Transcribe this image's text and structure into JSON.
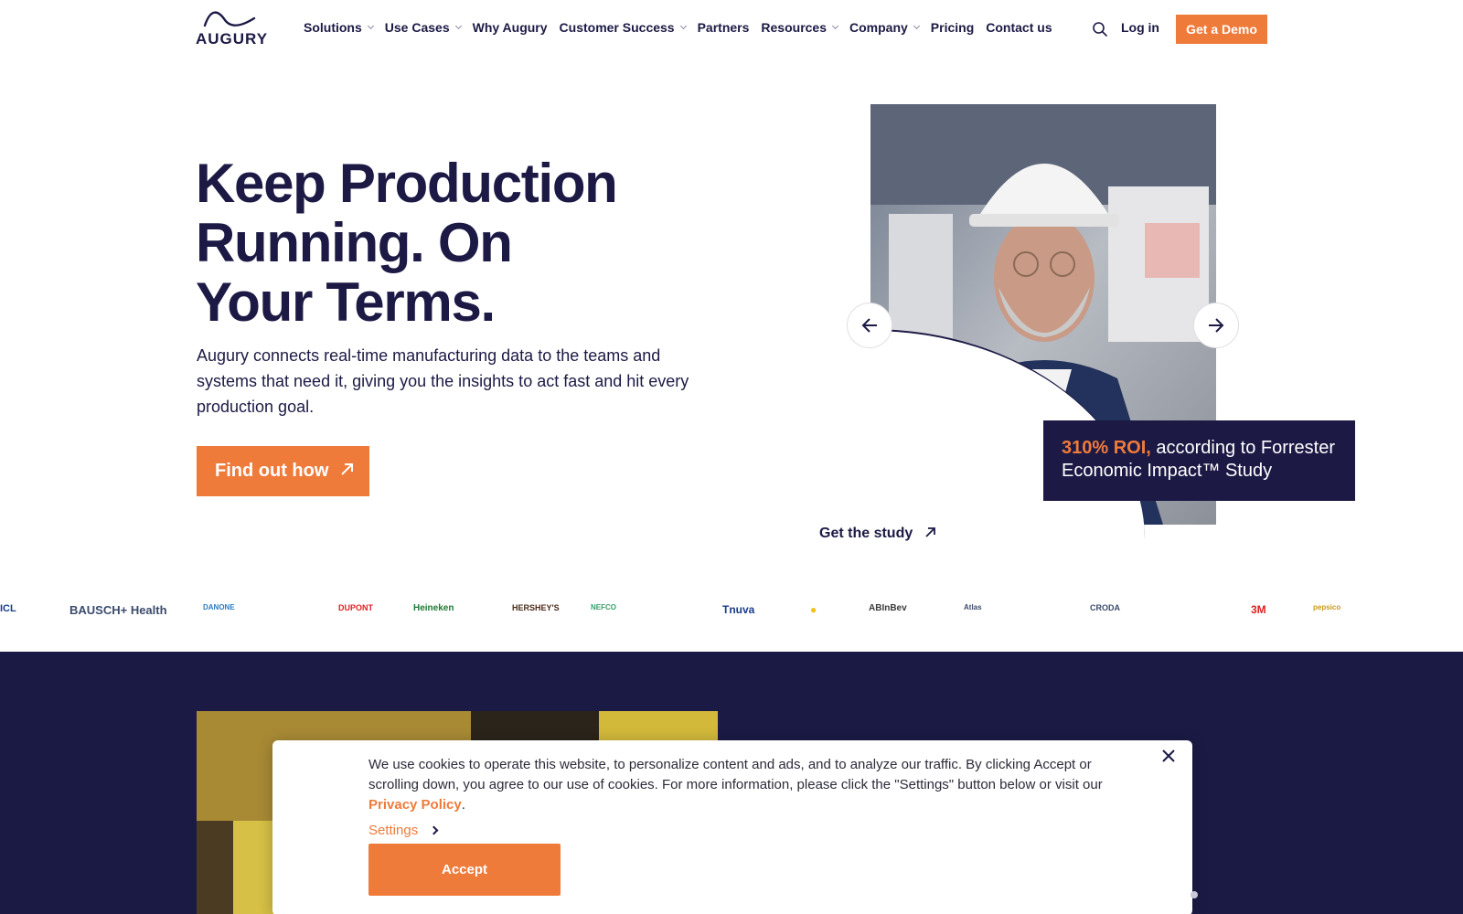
{
  "brand": {
    "logo_text": "AUGURY"
  },
  "nav": {
    "items": [
      {
        "label": "Solutions",
        "dropdown": true
      },
      {
        "label": "Use Cases",
        "dropdown": true
      },
      {
        "label": "Why Augury",
        "dropdown": false
      },
      {
        "label": "Customer Success",
        "dropdown": true
      },
      {
        "label": "Partners",
        "dropdown": false
      },
      {
        "label": "Resources",
        "dropdown": true
      },
      {
        "label": "Company",
        "dropdown": true
      },
      {
        "label": "Pricing",
        "dropdown": false
      },
      {
        "label": "Contact us",
        "dropdown": false
      }
    ],
    "search_icon": "search-icon",
    "login_label": "Log in",
    "demo_label": "Get a Demo"
  },
  "hero": {
    "title_line1": "Keep Production",
    "title_line2": "Running. On",
    "title_line3": "Your Terms.",
    "subtitle": "Augury connects real-time manufacturing data to the teams and systems that need it, giving you the insights to act fast and hit every production goal.",
    "cta_label": "Find out how",
    "cta_icon": "arrow-up-right-icon"
  },
  "carousel": {
    "prev_icon": "arrow-left-icon",
    "next_icon": "arrow-right-icon",
    "roi_accent": "310% ROI,",
    "roi_text_1": " according to Forrester",
    "roi_text_2": "Economic Impact™ Study",
    "study_link": "Get the study"
  },
  "logos": [
    "ICL",
    "BAUSCH+ Health",
    "DANONE",
    "DUPONT",
    "Heineken",
    "HERSHEY'S",
    "NEFCO",
    "Tnuva",
    "ABInBev",
    "Atlas",
    "CRODA",
    "3M",
    "pepsico"
  ],
  "cookie": {
    "text": "We use cookies to operate this website, to personalize content and ads, and to analyze our traffic. By clicking Accept or scrolling down, you agree to our use of cookies. For more information, please click the \"Settings\" button below or visit our ",
    "policy_link": "Privacy Policy",
    "period": ".",
    "settings_label": "Settings",
    "accept_label": "Accept",
    "close_icon": "close-icon"
  },
  "colors": {
    "navy": "#1c1a45",
    "orange": "#ef7b3b",
    "white": "#ffffff"
  }
}
